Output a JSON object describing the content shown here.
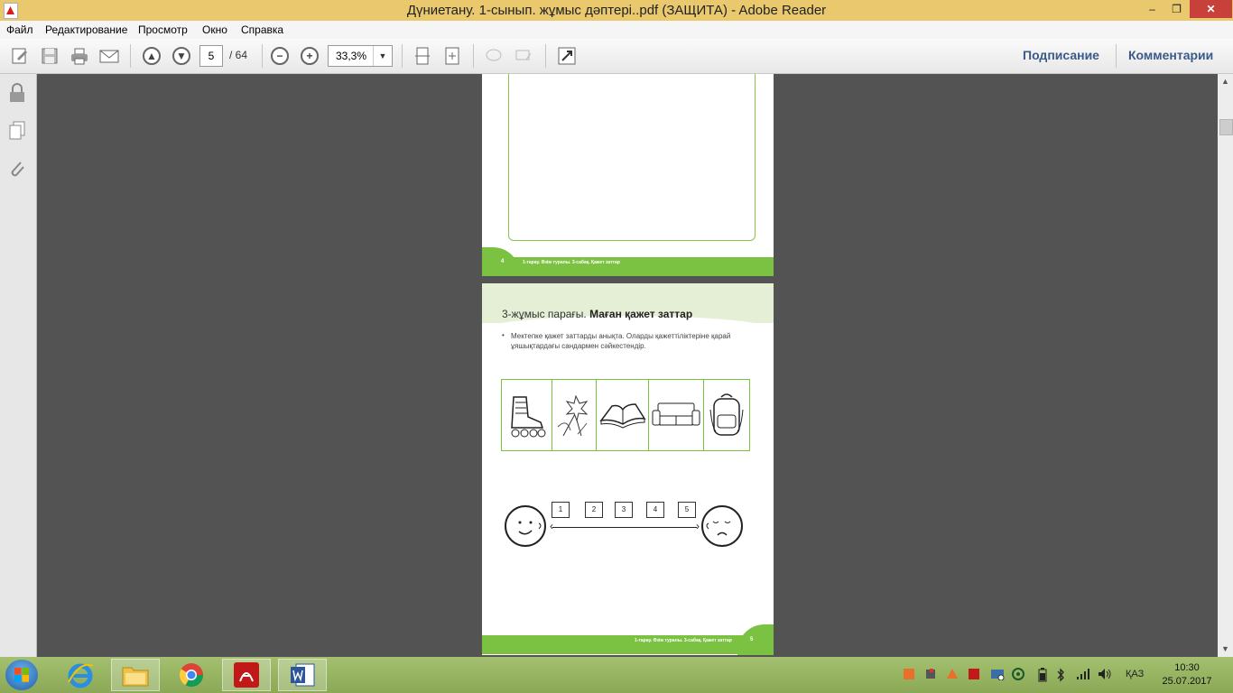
{
  "window": {
    "title": "Дүниетану. 1-сынып. жұмыс дәптері..pdf (ЗАЩИТА) - Adobe Reader",
    "min": "–",
    "max": "❐",
    "close": "✕"
  },
  "menu": [
    "Файл",
    "Редактирование",
    "Просмотр",
    "Окно",
    "Справка"
  ],
  "toolbar": {
    "page_current": "5",
    "page_total": "/ 64",
    "zoom": "33,3%",
    "sign_label": "Подписание",
    "comment_label": "Комментарии"
  },
  "page4": {
    "page_number": "4",
    "footer": "1-тарау. Өзім туралы. 3-сабақ. Қажет заттар"
  },
  "page5": {
    "title_prefix": "3-жұмыс парағы.",
    "title_bold": "Маған қажет заттар",
    "instruction": "Мектепке қажет заттарды анықта. Оларды қажеттіліктеріне қарай ұяшықтардағы сандармен сәйкестендір.",
    "numbers": [
      "1",
      "2",
      "3",
      "4",
      "5"
    ],
    "footer": "1-тарау. Өзім туралы. 3-сабақ. Қажет заттар",
    "page_number": "5"
  },
  "taskbar": {
    "lang": "ҚАЗ",
    "time": "10:30",
    "date": "25.07.2017"
  }
}
